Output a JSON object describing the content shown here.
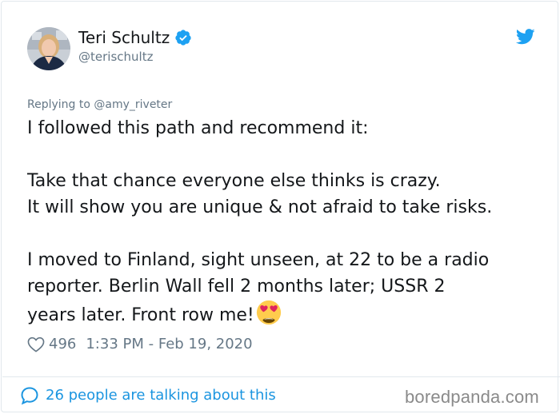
{
  "author": {
    "name": "Teri Schultz",
    "handle": "@terischultz",
    "verified": true,
    "avatar_icon": "profile-photo"
  },
  "platform_icon": "twitter-bird-icon",
  "reply": {
    "prefix": "Replying to",
    "mention": "@amy_riveter"
  },
  "tweet": {
    "lines": [
      "I followed this path and recommend it:",
      "Take that chance everyone else thinks is crazy.",
      "It will show you are unique & not afraid to take risks.",
      "I moved to Finland, sight unseen, at 22 to be a radio",
      "reporter. Berlin Wall fell 2 months later; USSR 2",
      "years later. Front row me!"
    ],
    "emoji": "heart-eyes-emoji"
  },
  "meta": {
    "likes": "496",
    "timestamp": "1:33 PM - Feb 19, 2020"
  },
  "footer": {
    "talking": "26 people are talking about this"
  },
  "watermark": "boredpanda.com",
  "colors": {
    "accent": "#1b95e0",
    "muted": "#657786",
    "text": "#14171a"
  }
}
